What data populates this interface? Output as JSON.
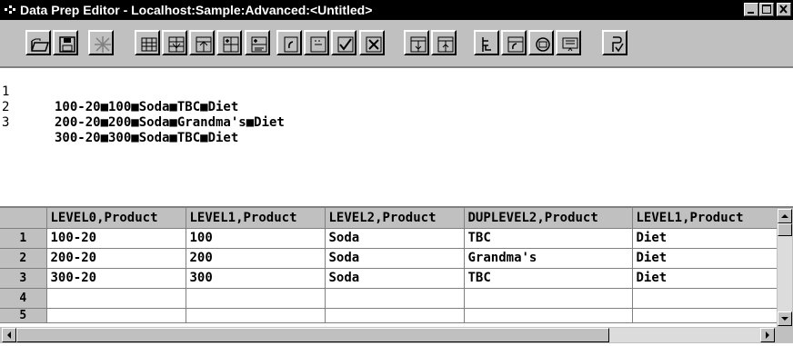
{
  "window": {
    "title": "Data Prep Editor - Localhost:Sample:Advanced:<Untitled>",
    "system_icon": "data-prep-icon",
    "caption_buttons": [
      "minimize-icon",
      "maximize-icon",
      "close-icon"
    ]
  },
  "toolbar": {
    "buttons": [
      {
        "name": "open-button",
        "icon": "open-folder-icon"
      },
      {
        "name": "save-button",
        "icon": "save-disk-icon"
      },
      {
        "name": "ignore-button",
        "icon": "star-cross-icon"
      },
      {
        "name": "fields-button",
        "icon": "grid-fields-icon"
      },
      {
        "name": "join-button",
        "icon": "join-fields-icon"
      },
      {
        "name": "split-button",
        "icon": "split-field-icon"
      },
      {
        "name": "create-field-button",
        "icon": "create-field-icon"
      },
      {
        "name": "create-text-field-button",
        "icon": "create-text-field-icon"
      },
      {
        "name": "replace-button",
        "icon": "replace-icon"
      },
      {
        "name": "field-properties-button",
        "icon": "field-properties-icon"
      },
      {
        "name": "select-button",
        "icon": "select-check-icon"
      },
      {
        "name": "reject-button",
        "icon": "reject-x-icon"
      },
      {
        "name": "move-field-button",
        "icon": "move-field-icon"
      },
      {
        "name": "sort-button",
        "icon": "sort-icon"
      },
      {
        "name": "associate-outline-button",
        "icon": "outline-icon"
      },
      {
        "name": "data-load-settings-button",
        "icon": "data-settings-icon"
      },
      {
        "name": "dimension-build-button",
        "icon": "dimension-build-icon"
      },
      {
        "name": "view-button",
        "icon": "view-icon"
      },
      {
        "name": "validate-button",
        "icon": "validate-icon"
      }
    ]
  },
  "text_pane": {
    "lines": [
      {
        "number": "1",
        "text": "100-20■100■Soda■TBC■Diet"
      },
      {
        "number": "2",
        "text": "200-20■200■Soda■Grandma's■Diet"
      },
      {
        "number": "3",
        "text": "300-20■300■Soda■TBC■Diet"
      }
    ]
  },
  "grid": {
    "columns": [
      "LEVEL0,Product",
      "LEVEL1,Product",
      "LEVEL2,Product",
      "DUPLEVEL2,Product",
      "LEVEL1,Product"
    ],
    "rows": [
      {
        "num": "1",
        "cells": [
          "100-20",
          "100",
          "Soda",
          "TBC",
          "Diet"
        ]
      },
      {
        "num": "2",
        "cells": [
          "200-20",
          "200",
          "Soda",
          "Grandma's",
          "Diet"
        ]
      },
      {
        "num": "3",
        "cells": [
          "300-20",
          "300",
          "Soda",
          "TBC",
          "Diet"
        ]
      },
      {
        "num": "4",
        "cells": [
          "",
          "",
          "",
          "",
          ""
        ]
      },
      {
        "num": "5",
        "cells": [
          "",
          "",
          "",
          "",
          ""
        ]
      }
    ]
  },
  "colors": {
    "title_bar": "#000000",
    "face": "#c0c0c0",
    "pane": "#ffffff"
  }
}
